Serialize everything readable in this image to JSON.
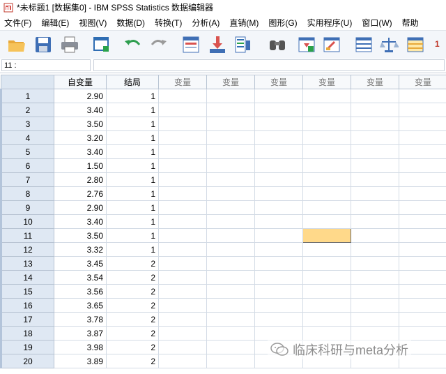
{
  "window": {
    "title": "*未标题1 [数据集0] - IBM SPSS Statistics 数据编辑器"
  },
  "menu": [
    "文件(F)",
    "编辑(E)",
    "视图(V)",
    "数据(D)",
    "转换(T)",
    "分析(A)",
    "直销(M)",
    "图形(G)",
    "实用程序(U)",
    "窗口(W)",
    "帮助"
  ],
  "toolbar": {
    "icons": [
      "open-folder-icon",
      "save-icon",
      "print-icon",
      "dialog-recall-icon",
      "undo-icon",
      "redo-icon",
      "goto-case-icon",
      "goto-variable-icon",
      "variables-icon",
      "find-icon",
      "insert-cases-icon",
      "insert-variable-icon",
      "split-file-icon",
      "weight-cases-icon",
      "select-cases-icon"
    ],
    "value_labels_badge": "1"
  },
  "cell_editor": {
    "reference": "11 :",
    "value": ""
  },
  "grid": {
    "columns": [
      "自变量",
      "结局",
      "变量",
      "变量",
      "变量",
      "变量",
      "变量",
      "变量"
    ],
    "rows": [
      {
        "n": "1",
        "v1": "2.90",
        "v2": "1"
      },
      {
        "n": "2",
        "v1": "3.40",
        "v2": "1"
      },
      {
        "n": "3",
        "v1": "3.50",
        "v2": "1"
      },
      {
        "n": "4",
        "v1": "3.20",
        "v2": "1"
      },
      {
        "n": "5",
        "v1": "3.40",
        "v2": "1"
      },
      {
        "n": "6",
        "v1": "1.50",
        "v2": "1"
      },
      {
        "n": "7",
        "v1": "2.80",
        "v2": "1"
      },
      {
        "n": "8",
        "v1": "2.76",
        "v2": "1"
      },
      {
        "n": "9",
        "v1": "2.90",
        "v2": "1"
      },
      {
        "n": "10",
        "v1": "3.40",
        "v2": "1"
      },
      {
        "n": "11",
        "v1": "3.50",
        "v2": "1"
      },
      {
        "n": "12",
        "v1": "3.32",
        "v2": "1"
      },
      {
        "n": "13",
        "v1": "3.45",
        "v2": "2"
      },
      {
        "n": "14",
        "v1": "3.54",
        "v2": "2"
      },
      {
        "n": "15",
        "v1": "3.56",
        "v2": "2"
      },
      {
        "n": "16",
        "v1": "3.65",
        "v2": "2"
      },
      {
        "n": "17",
        "v1": "3.78",
        "v2": "2"
      },
      {
        "n": "18",
        "v1": "3.87",
        "v2": "2"
      },
      {
        "n": "19",
        "v1": "3.98",
        "v2": "2"
      },
      {
        "n": "20",
        "v1": "3.89",
        "v2": "2"
      }
    ],
    "active_cell": {
      "row": 11,
      "column": 6
    }
  },
  "watermark": {
    "text": "临床科研与meta分析"
  },
  "colors": {
    "active_cell": "#ffd98a",
    "row_header": "#dfe8f3",
    "grid_line": "#d3dbe5"
  }
}
